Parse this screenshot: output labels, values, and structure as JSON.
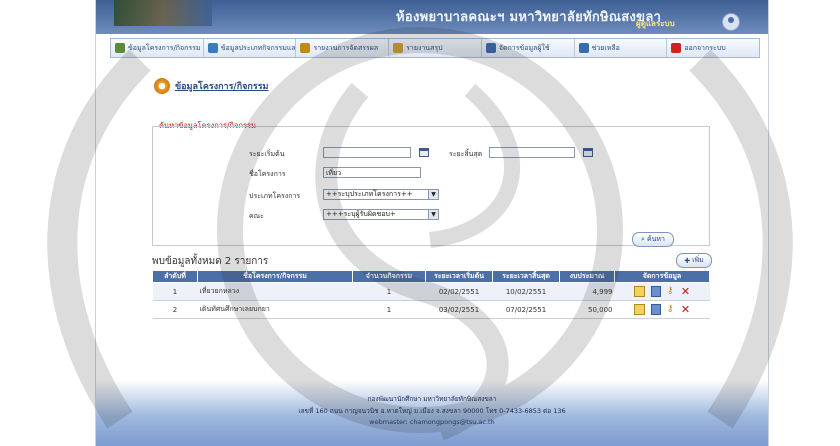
{
  "header": {
    "title": "ห้องพยาบาลคณะฯ มหาวิทยาลัยทักษิณสงขลา",
    "user_label": "ผู้ดูแลระบบ"
  },
  "nav": {
    "items": [
      {
        "label": "ข้อมูลโครงการ/กิจกรรม",
        "icon": "folder-icon",
        "color": "#5a8a3a"
      },
      {
        "label": "ข้อมูลประเภทกิจกรรมและโครงการ",
        "icon": "list-icon",
        "color": "#3a7ac0"
      },
      {
        "label": "รายงานการจัดสรรผล",
        "icon": "report-icon",
        "color": "#c08a20"
      },
      {
        "label": "รายงานสรุป",
        "icon": "chart-icon",
        "color": "#d0a030"
      },
      {
        "label": "จัดการข้อมูลผู้ใช้",
        "icon": "users-icon",
        "color": "#3a6ab0"
      },
      {
        "label": "ช่วยเหลือ",
        "icon": "help-icon",
        "color": "#3a6ab0"
      },
      {
        "label": "ออกจากระบบ",
        "icon": "logout-icon",
        "color": "#d02020"
      }
    ]
  },
  "page": {
    "title": "ข้อมูลโครงการ/กิจกรรม"
  },
  "search": {
    "legend": "ค้นหาข้อมูลโครงการ/กิจกรรม",
    "start_label": "ระยะเริ่มต้น",
    "start_value": "",
    "end_label": "ระยะสิ้นสุด",
    "end_value": "",
    "name_label": "ชื่อโครงการ",
    "name_value": "เที่ยว",
    "type_label": "ประเภทโครงการ",
    "type_value": "++ระบุประเภทโครงการ++",
    "faculty_label": "คณะ",
    "faculty_value": "+++ระบุผู้รับผิดชอบ+",
    "button_label": "ค้นหา"
  },
  "results": {
    "title": "พบข้อมูลทั้งหมด 2 รายการ",
    "add_label": "เพิ่ม",
    "columns": [
      "ลำดับที่",
      "ชื่อโครงการ/กิจกรรม",
      "จำนวนกิจกรรม",
      "ระยะเวลาเริ่มต้น",
      "ระยะเวลาสิ้นสุด",
      "งบประมาณ",
      "จัดการข้อมูล"
    ],
    "rows": [
      {
        "no": "1",
        "name": "เที่ยวยกหลวง",
        "count": "1",
        "start": "02/02/2551",
        "end": "10/02/2551",
        "budget": "4,999"
      },
      {
        "no": "2",
        "name": "เดินทัศนศึกษาเลยบกยา",
        "count": "1",
        "start": "03/02/2551",
        "end": "07/02/2551",
        "budget": "50,000"
      }
    ]
  },
  "footer": {
    "line1": "กองพัฒนานักศึกษา มหาวิทยาลัยทักษิณสงขลา",
    "line2": "เลขที่ 160 ถนน กาญจนวนิช อ.หาดใหญ่ ม.เมือง จ.สงขลา 90000 โทร 0-7433-6853 ต่อ 136",
    "line3": "webmaster: chamongpongs@tsu.ac.th"
  }
}
